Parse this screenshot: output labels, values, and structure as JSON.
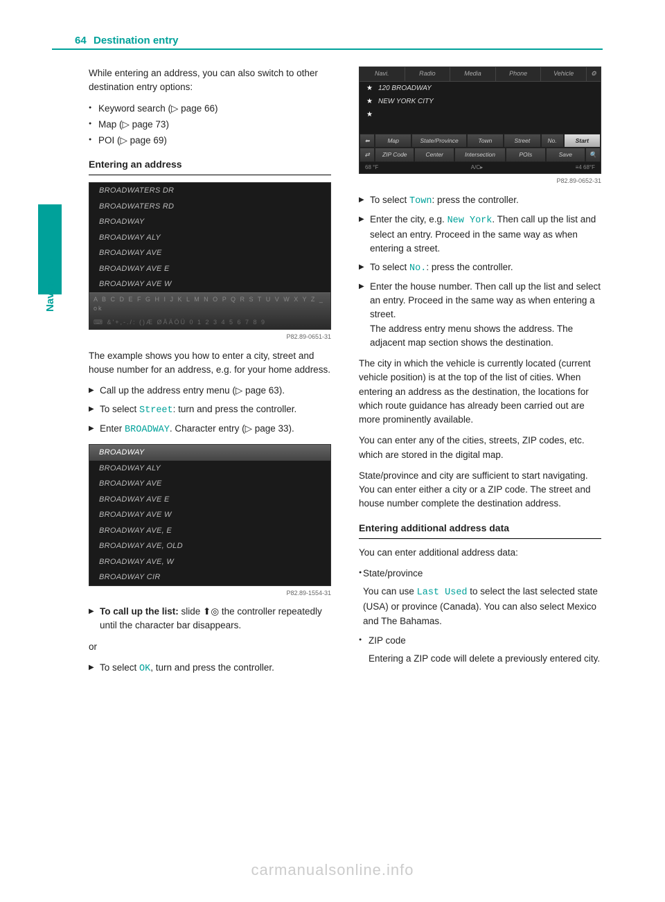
{
  "page_number": "64",
  "header_title": "Destination entry",
  "side_label": "Navigation",
  "watermark": "carmanualsonline.info",
  "col1": {
    "intro": "While entering an address, you can also switch to other destination entry options:",
    "opts": [
      "Keyword search (▷ page 66)",
      "Map (▷ page 73)",
      "POI (▷ page 69)"
    ],
    "sec1_h": "Entering an address",
    "ss1": {
      "rows": [
        "BROADWATERS DR",
        "BROADWATERS RD",
        "BROADWAY",
        "BROADWAY ALY",
        "BROADWAY AVE",
        "BROADWAY AVE E",
        "BROADWAY AVE W"
      ],
      "bar1": "A B C D E F G H I J K L M N O P Q R S T U V W X Y Z _ ok",
      "bar2": "⌨  &'+,-./: ()Æ ØÅÄÖÜ 0 1 2 3 4 5 6 7 8 9",
      "caption": "P82.89-0651-31"
    },
    "p1": "The example shows you how to enter a city, street and house number for an address, e.g. for your home address.",
    "steps1": [
      {
        "t": "Call up the address entry menu (▷ page 63)."
      },
      {
        "t": "To select ",
        "mono": "Street",
        "t2": ": turn and press the controller."
      },
      {
        "t": "Enter ",
        "mono": "BROADWAY",
        "t2": ". Character entry (▷ page 33)."
      }
    ],
    "ss2": {
      "rows": [
        "BROADWAY",
        "BROADWAY ALY",
        "BROADWAY AVE",
        "BROADWAY AVE E",
        "BROADWAY AVE W",
        "BROADWAY AVE, E",
        "BROADWAY AVE, OLD",
        "BROADWAY AVE, W",
        "BROADWAY CIR"
      ],
      "caption": "P82.89-1554-31"
    },
    "step2_pre": "To call up the list:",
    "step2_body": " slide ⬆◎ the controller repeatedly until the character bar disappears.",
    "or": "or",
    "step3_pre": "To select ",
    "step3_mono": "OK",
    "step3_post": ", turn and press the controller."
  },
  "col2": {
    "ss3": {
      "tabs": [
        "Navi.",
        "Radio",
        "Media",
        "Phone",
        "Vehicle",
        "⚙"
      ],
      "addr1": "120 BROADWAY",
      "addr2": "NEW YORK CITY",
      "addr3": "",
      "row1": [
        "⬅",
        "Map",
        "State/Province",
        "Town",
        "Street",
        "No.",
        "Start"
      ],
      "row2": [
        "⇄",
        "ZIP Code",
        "Center",
        "Intersection",
        "POIs",
        "Save",
        "🔍"
      ],
      "status_l": "68 °F",
      "status_c": "A/C▸",
      "status_r": "≡4        68°F",
      "caption": "P82.89-0652-31"
    },
    "steps2": [
      {
        "t": "To select ",
        "mono": "Town",
        "t2": ": press the controller."
      },
      {
        "t": "Enter the city, e.g. ",
        "mono": "New York",
        "t2": ". Then call up the list and select an entry. Proceed in the same way as when entering a street."
      },
      {
        "t": "To select ",
        "mono": "No.",
        "t2": ": press the controller."
      },
      {
        "t": "Enter the house number. Then call up the list and select an entry. Proceed in the same way as when entering a street.",
        "extra": "The address entry menu shows the address. The adjacent map section shows the destination."
      }
    ],
    "p2": "The city in which the vehicle is currently located (current vehicle position) is at the top of the list of cities. When entering an address as the destination, the locations for which route guidance has already been carried out are more prominently available.",
    "p3": "You can enter any of the cities, streets, ZIP codes, etc. which are stored in the digital map.",
    "p4": "State/province and city are sufficient to start navigating. You can enter either a city or a ZIP code. The street and house number complete the destination address.",
    "sec2_h": "Entering additional address data",
    "p5": "You can enter additional address data:",
    "b1_label": "State/province",
    "b1_t1": "You can use ",
    "b1_mono": "Last Used",
    "b1_t2": " to select the last selected state (USA) or province (Canada). You can also select Mexico and The Bahamas.",
    "b2_label": "ZIP code",
    "b2_body": "Entering a ZIP code will delete a previously entered city."
  }
}
